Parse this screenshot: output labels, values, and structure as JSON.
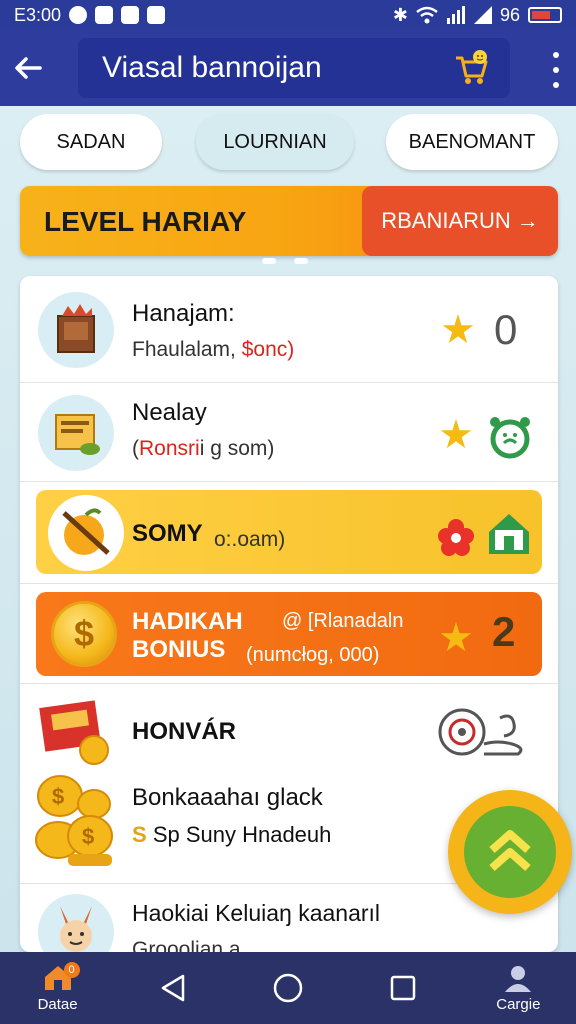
{
  "status_bar": {
    "time": "E3:00",
    "battery_text": "96"
  },
  "app_bar": {
    "title": "Viasal bannoijan"
  },
  "tabs": [
    {
      "label": "SADAN"
    },
    {
      "label": "LOURNIAN"
    },
    {
      "label": "BAENOMANT"
    }
  ],
  "level_banner": {
    "title": "LEVEL HARIAY",
    "button_label": "RBANIARUN",
    "button_arrow": "→"
  },
  "list": [
    {
      "title": "Hanajam:",
      "sub_prefix": "Fhaulalam, ",
      "sub_highlight": "$onc)",
      "right_value": "0"
    },
    {
      "title": "Nealay",
      "sub_prefix": "(",
      "sub_highlight": "Ronsri",
      "sub_suffix": "i g som)"
    },
    {
      "title": "SOMY",
      "sub": "o:.oam)"
    },
    {
      "title_line1": "HADIKAH",
      "title_line2": "BONIUS",
      "tag": "@ [Rlanadaln",
      "sub": "(numcłog, 000)",
      "right_value": "2"
    },
    {
      "title": "HONVÁR"
    },
    {
      "title": "Bonkaaahaı glack",
      "sub_symbol": "S",
      "sub": "Sp Suny Hnadeuh"
    },
    {
      "title": "Haokiai Keluiaŋ kaanarıl",
      "sub": "Grooolian a"
    }
  ],
  "bottom_nav": [
    {
      "label": "Datae",
      "badge": "0"
    },
    {
      "label": ""
    },
    {
      "label": ""
    },
    {
      "label": ""
    },
    {
      "label": "Cargie"
    }
  ],
  "colors": {
    "app_bar": "#2e3c9e",
    "banner_orange": "#f77b10",
    "banner_button": "#e8502a",
    "star": "#f5bb12",
    "bottom_nav": "#2b3268"
  }
}
